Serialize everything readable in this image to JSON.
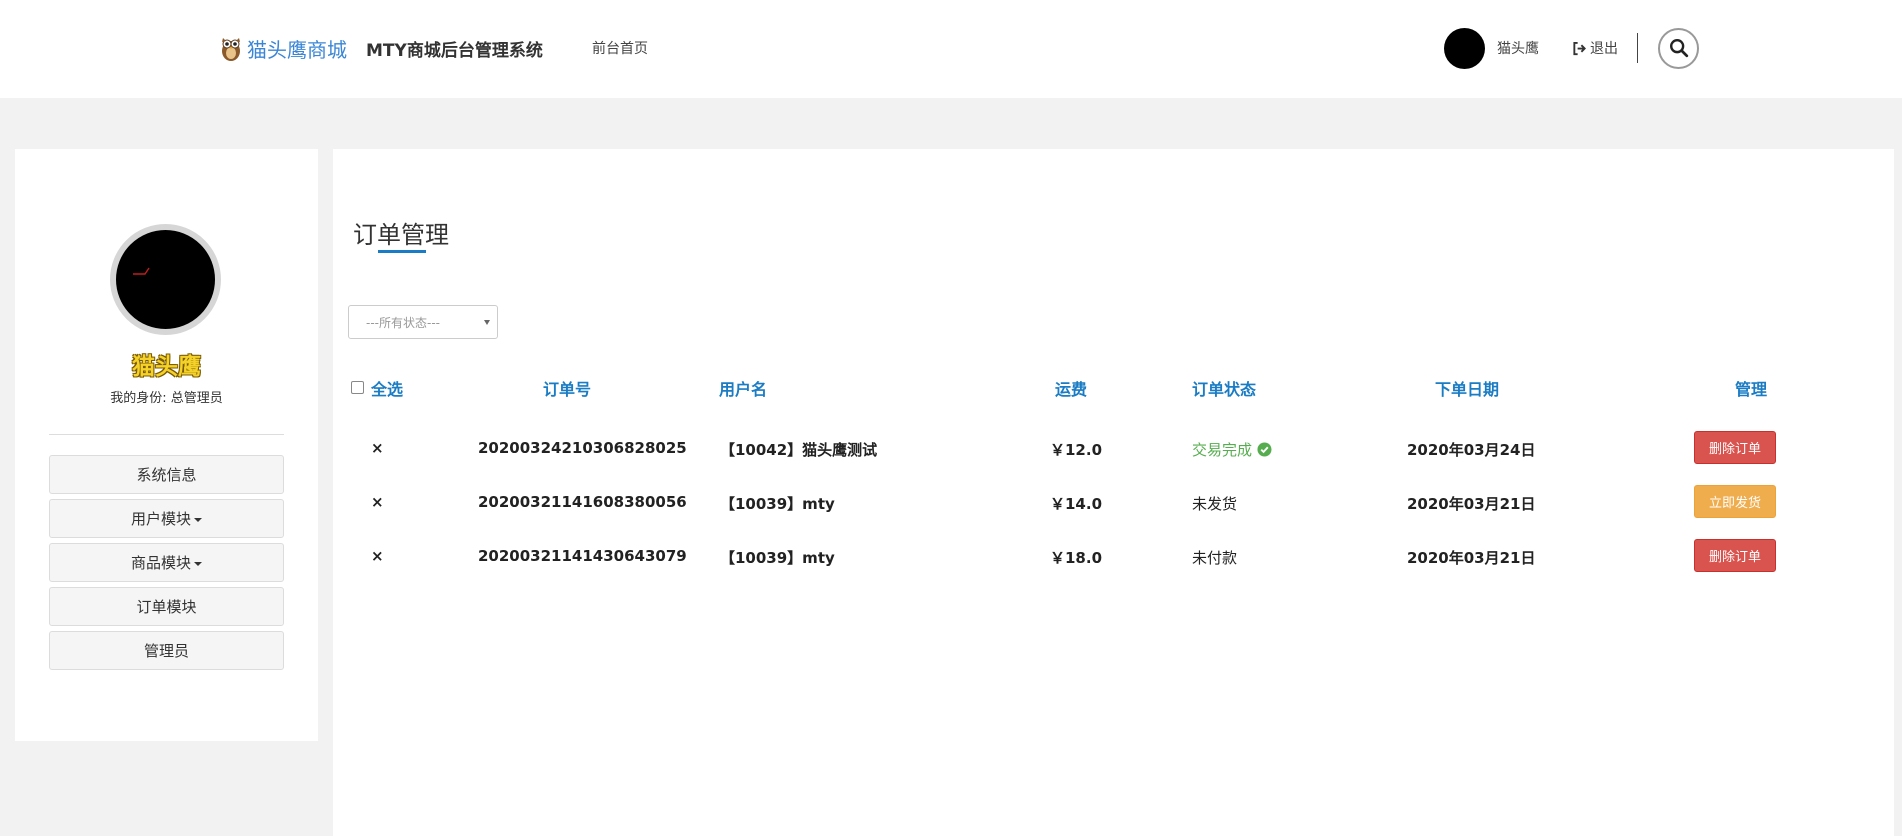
{
  "header": {
    "brand_name": "猫头鹰商城",
    "system_title": "MTY商城后台管理系统",
    "home_link": "前台首页",
    "username": "猫头鹰",
    "logout_label": "退出"
  },
  "sidebar": {
    "name": "猫头鹰",
    "role": "我的身份: 总管理员",
    "menu": [
      {
        "label": "系统信息"
      },
      {
        "label": "用户模块"
      },
      {
        "label": "商品模块"
      },
      {
        "label": "订单模块"
      },
      {
        "label": "管理员"
      }
    ]
  },
  "main": {
    "title": "订单管理",
    "filter_value": "---所有状态---",
    "columns": {
      "select_all": "全选",
      "order_no": "订单号",
      "user": "用户名",
      "freight": "运费",
      "status": "订单状态",
      "date": "下单日期",
      "manage": "管理"
    },
    "rows": [
      {
        "mark": "×",
        "order_no": "20200324210306828025",
        "user": "【10042】猫头鹰测试",
        "freight": "￥12.0",
        "status": "交易完成",
        "date": "2020年03月24日",
        "action": "删除订单"
      },
      {
        "mark": "×",
        "order_no": "20200321141608380056",
        "user": "【10039】mty",
        "freight": "￥14.0",
        "status": "未发货",
        "date": "2020年03月21日",
        "action": "立即发货"
      },
      {
        "mark": "×",
        "order_no": "20200321141430643079",
        "user": "【10039】mty",
        "freight": "￥18.0",
        "status": "未付款",
        "date": "2020年03月21日",
        "action": "删除订单"
      }
    ]
  },
  "colors": {
    "brand": "#3a86d6",
    "accent": "#1a7cc4",
    "success": "#56ad4f",
    "danger": "#d9534f",
    "warning": "#f0ad4e"
  }
}
